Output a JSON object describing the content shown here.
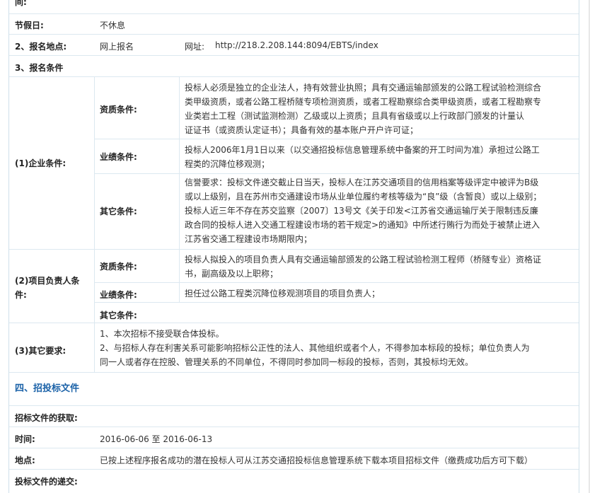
{
  "top_cut_label": "间:",
  "holiday": {
    "label": "节假日:",
    "value": "不休息"
  },
  "signup_place": {
    "label": "2、报名地点:",
    "value": "网上报名",
    "url_label": "网址:",
    "url": "http://218.2.208.144:8094/EBTS/index"
  },
  "signup_cond": {
    "label": "3、报名条件"
  },
  "enterprise": {
    "label": "(1)企业条件:",
    "qual_label": "资质条件:",
    "qual_lines": [
      "投标人必须是独立的企业法人，持有效营业执照；具有交通运输部颁发的公路工程试验检测综合",
      "类甲级资质，或者公路工程桥隧专项检测资质，或者工程勘察综合类甲级资质，或者工程勘察专",
      "业类岩土工程（测试监测检测）乙级或以上资质；且具有省级或以上行政部门颁发的计量认",
      "证证书（或资质认定证书）；具备有效的基本账户开户许可证；"
    ],
    "perf_label": "业绩条件:",
    "perf_lines": [
      "投标人2006年1月1日以来（以交通招投标信息管理系统中备案的开工时间为准）承担过公路工",
      "程类的沉降位移观测；"
    ],
    "other_label": "其它条件:",
    "other_lines": [
      "信誉要求：投标文件递交截止日当天，投标人在江苏交通项目的信用档案等级评定中被评为B级",
      "或以上级别，且在苏州市交通建设市场从业单位履约考核等级为“良”级（含暂良）或以上级别；",
      "投标人近三年不存在苏交监察〔2007〕13号文《关于印发<江苏省交通运输厅关于限制违反廉",
      "政合同的投标人进入交通工程建设市场的若干规定>的通知》中所述行贿行为而处于被禁止进入",
      "江苏省交通工程建设市场期限内；"
    ]
  },
  "pm": {
    "label_line1": "(2)项目负责人条",
    "label_line2": "件:",
    "qual_label": "资质条件:",
    "qual_lines": [
      "投标人拟投入的项目负责人具有交通运输部颁发的公路工程试验检测工程师（桥隧专业）资格证",
      "书，副高级及以上职称；"
    ],
    "perf_label": "业绩条件:",
    "perf_lines": [
      "担任过公路工程类沉降位移观测项目的项目负责人；"
    ],
    "other_label": "其它条件:"
  },
  "other_req": {
    "label": "(3)其它要求:",
    "lines": [
      "1、本次招标不接受联合体投标。",
      "2、与招标人存在利害关系可能影响招标公正性的法人、其他组织或者个人，不得参加本标段的投标；单位负责人为",
      "同一人或者存在控股、管理关系的不同单位，不得同时参加同一标段的投标，否则，其投标均无效。"
    ]
  },
  "section4": {
    "title": "四、招投标文件"
  },
  "doc_get": {
    "label": "招标文件的获取:"
  },
  "time": {
    "label": "时间:",
    "value": "2016-06-06 至 2016-06-13"
  },
  "place": {
    "label": "地点:",
    "value": "已按上述程序报名成功的潜在投标人可从江苏交通招投标信息管理系统下载本项目招标文件（缴费成功后方可下载）"
  },
  "doc_submit": {
    "label": "投标文件的递交:"
  }
}
